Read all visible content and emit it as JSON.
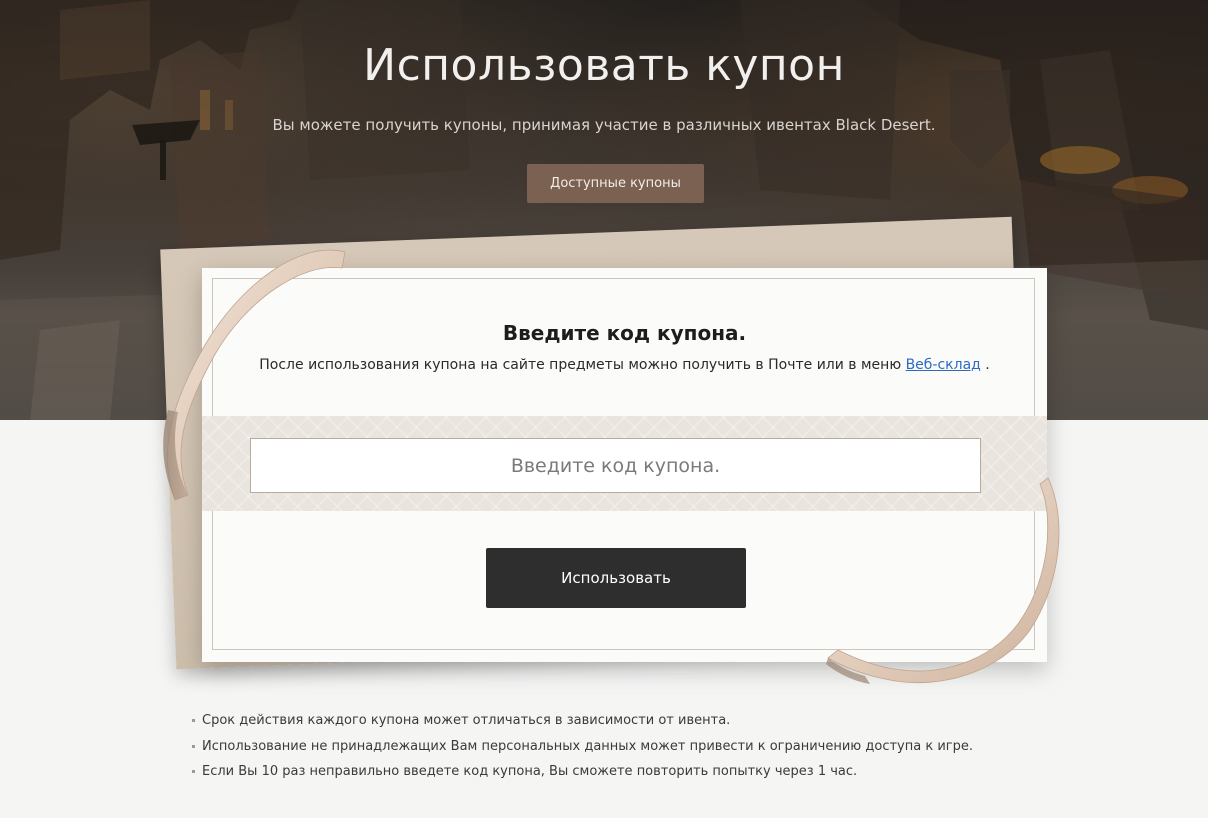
{
  "hero": {
    "title": "Использовать купон",
    "subtitle": "Вы можете получить купоны, принимая участие в различных ивентах Black Desert.",
    "available_coupons_label": "Доступные купоны"
  },
  "card": {
    "title": "Введите код купона.",
    "description_prefix": "После использования купона на сайте предметы можно получить в Почте или в меню ",
    "web_storage_link": "Веб-склад",
    "description_suffix": " .",
    "input_value": "",
    "input_placeholder": "Введите код купона.",
    "submit_label": "Использовать"
  },
  "notes": [
    "Срок действия каждого купона может отличаться в зависимости от ивента.",
    "Использование не принадлежащих Вам персональных данных может привести к ограничению доступа к игре.",
    "Если Вы 10 раз неправильно введете код купона, Вы сможете повторить попытку через 1 час."
  ],
  "colors": {
    "accent_button": "#7b6152",
    "submit_button": "#2e2e2e",
    "link": "#2d6bbd",
    "ribbon": "#e6d2c2"
  }
}
